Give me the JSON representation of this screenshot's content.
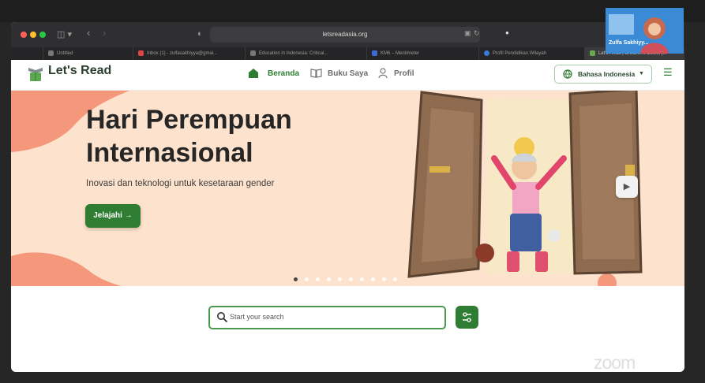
{
  "browser": {
    "url": "letsreadasia.org",
    "tabs": [
      {
        "label": "Untitled"
      },
      {
        "label": "Inbox (1) - zulfasakhiyya@gmai..."
      },
      {
        "label": "Education in Indonesia: Critical..."
      },
      {
        "label": "KM6 – Mentimeter"
      },
      {
        "label": "Profil Pendidikan Wilayah"
      },
      {
        "label": "Let's Read | Children's Books |..."
      }
    ]
  },
  "site": {
    "logo_text": "Let's Read",
    "nav": [
      {
        "label": "Beranda",
        "icon": "home-icon"
      },
      {
        "label": "Buku Saya",
        "icon": "book-icon"
      },
      {
        "label": "Profil",
        "icon": "user-icon"
      }
    ],
    "language": {
      "label": "Bahasa Indonesia",
      "icon": "globe-icon"
    }
  },
  "hero": {
    "title_line1": "Hari Perempuan",
    "title_line2": "Internasional",
    "subtitle": "Inovasi dan teknologi untuk kesetaraan gender",
    "cta_label": "Jelajahi",
    "cta_arrow": "→",
    "slide_count": 10,
    "active_slide": 1
  },
  "search": {
    "placeholder": "Start your search"
  },
  "webcam": {
    "name": "Zulfa Sakhiyy..."
  },
  "zoom_watermark": "zoom",
  "colors": {
    "brand_green": "#2f7d32",
    "hero_bg": "#fde2cd",
    "hero_accent": "#f4977a"
  }
}
